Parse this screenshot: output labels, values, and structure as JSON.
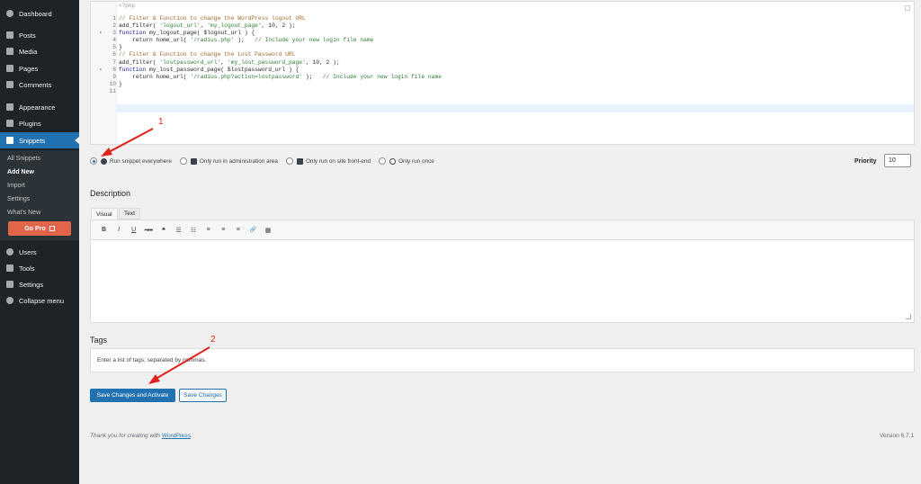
{
  "sidebar": {
    "items": [
      {
        "label": "Dashboard",
        "icon": "dashboard-icon"
      },
      {
        "label": "Posts",
        "icon": "pin-icon"
      },
      {
        "label": "Media",
        "icon": "media-icon"
      },
      {
        "label": "Pages",
        "icon": "pages-icon"
      },
      {
        "label": "Comments",
        "icon": "comments-icon"
      },
      {
        "label": "Appearance",
        "icon": "brush-icon"
      },
      {
        "label": "Plugins",
        "icon": "plugin-icon"
      },
      {
        "label": "Snippets",
        "icon": "scissors-icon"
      },
      {
        "label": "Users",
        "icon": "users-icon"
      },
      {
        "label": "Tools",
        "icon": "wrench-icon"
      },
      {
        "label": "Settings",
        "icon": "settings-icon"
      },
      {
        "label": "Collapse menu",
        "icon": "collapse-icon"
      }
    ],
    "submenu": [
      "All Snippets",
      "Add New",
      "Import",
      "Settings",
      "What's New"
    ],
    "gopro": "Go Pro"
  },
  "editor": {
    "first_line_partial": "<?php",
    "lines": [
      {
        "n": "1",
        "parts": [
          {
            "t": "// Filter & Function to change the WordPress logout URL",
            "c": "c-com"
          }
        ]
      },
      {
        "n": "2",
        "parts": [
          {
            "t": "add_filter( ",
            "c": "c-pl"
          },
          {
            "t": "'logout_url'",
            "c": "c-str"
          },
          {
            "t": ", ",
            "c": "c-pl"
          },
          {
            "t": "'my_logout_page'",
            "c": "c-str"
          },
          {
            "t": ", 10, 2 );",
            "c": "c-pl"
          }
        ]
      },
      {
        "n": "3",
        "fold": true,
        "parts": [
          {
            "t": "function ",
            "c": "c-fn"
          },
          {
            "t": "my_logout_page( $logout_url ) {",
            "c": "c-pl"
          }
        ]
      },
      {
        "n": "4",
        "parts": [
          {
            "t": "    return home_url( ",
            "c": "c-pl"
          },
          {
            "t": "'/radius.php'",
            "c": "c-str"
          },
          {
            "t": " );   ",
            "c": "c-pl"
          },
          {
            "t": "// Include your new login file name",
            "c": "c-str"
          }
        ]
      },
      {
        "n": "5",
        "parts": [
          {
            "t": "}",
            "c": "c-pl"
          }
        ]
      },
      {
        "n": "6",
        "parts": [
          {
            "t": "// Filter & Function to change the Lost Password URL",
            "c": "c-com"
          }
        ]
      },
      {
        "n": "7",
        "parts": [
          {
            "t": "add_filter( ",
            "c": "c-pl"
          },
          {
            "t": "'lostpassword_url'",
            "c": "c-str"
          },
          {
            "t": ", ",
            "c": "c-pl"
          },
          {
            "t": "'my_lost_password_page'",
            "c": "c-str"
          },
          {
            "t": ", 10, 2 );",
            "c": "c-pl"
          }
        ]
      },
      {
        "n": "8",
        "fold": true,
        "parts": [
          {
            "t": "function ",
            "c": "c-fn"
          },
          {
            "t": "my_lost_password_page( $lostpassword_url ) {",
            "c": "c-pl"
          }
        ]
      },
      {
        "n": "9",
        "parts": [
          {
            "t": "    return home_url( ",
            "c": "c-pl"
          },
          {
            "t": "'/radius.php?action=lostpassword'",
            "c": "c-str"
          },
          {
            "t": " );   ",
            "c": "c-pl"
          },
          {
            "t": "// Include your new login file name",
            "c": "c-str"
          }
        ]
      },
      {
        "n": "10",
        "parts": [
          {
            "t": "}",
            "c": "c-pl"
          }
        ]
      },
      {
        "n": "11",
        "parts": []
      }
    ]
  },
  "scope": {
    "options": [
      {
        "label": "Run snippet everywhere",
        "checked": true,
        "icon": "globe-icon"
      },
      {
        "label": "Only run in administration area",
        "checked": false,
        "icon": "wrench-icon"
      },
      {
        "label": "Only run on site front-end",
        "checked": false,
        "icon": "hammer-icon"
      },
      {
        "label": "Only run once",
        "checked": false,
        "icon": "clock-icon"
      }
    ],
    "priority_label": "Priority",
    "priority_value": "10"
  },
  "description": {
    "title": "Description",
    "tab_visual": "Visual",
    "tab_text": "Text",
    "toolbar": [
      "B",
      "I",
      "U",
      "ABC",
      "❝",
      "☰",
      "☷",
      "≡",
      "≡",
      "≡",
      "🔗",
      "▦"
    ]
  },
  "tags": {
    "title": "Tags",
    "placeholder": "Enter a list of tags; separated by commas."
  },
  "buttons": {
    "activate": "Save Changes and Activate",
    "save": "Save Changes"
  },
  "footer": {
    "thanks_prefix": "Thank you for creating with ",
    "thanks_link": "WordPress",
    "thanks_suffix": ".",
    "version": "Version 6.7.1"
  },
  "annotations": {
    "one": "1",
    "two": "2",
    "color": "#e0221c"
  }
}
